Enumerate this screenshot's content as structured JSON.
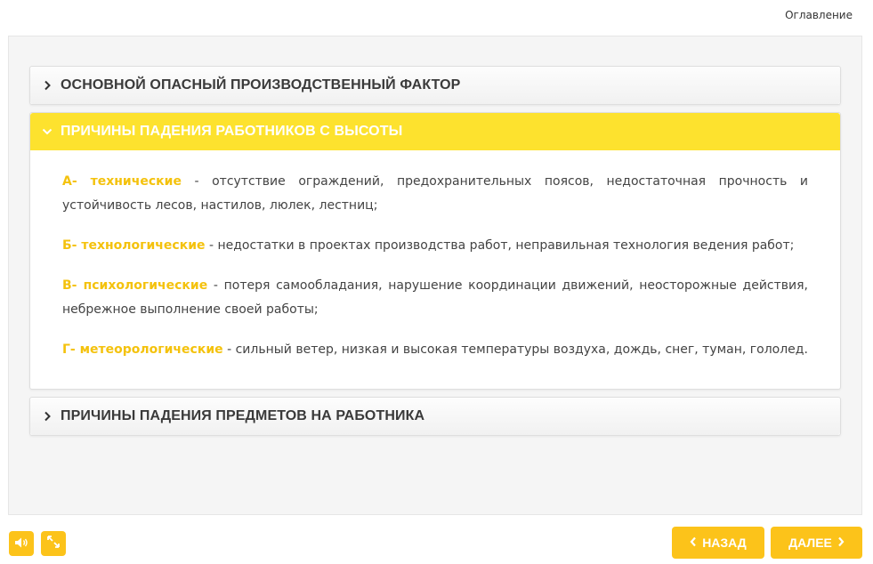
{
  "header": {
    "toc_label": "Оглавление"
  },
  "accordion": {
    "items": [
      {
        "title": "ОСНОВНОЙ ОПАСНЫЙ ПРОИЗВОДСТВЕННЫЙ ФАКТОР",
        "open": false
      },
      {
        "title": "ПРИЧИНЫ ПАДЕНИЯ РАБОТНИКОВ С ВЫСОТЫ",
        "open": true,
        "paragraphs": [
          {
            "term": "А- технические",
            "text": " - отсутствие ограждений, предохранительных поясов, недостаточная прочность и устойчивость лесов, настилов, люлек, лестниц;"
          },
          {
            "term": "Б- технологические",
            "text": " - недостатки в проектах производства работ, неправильная технология ведения работ;"
          },
          {
            "term": "В- психологические",
            "text": " - потеря самообладания, нарушение координации движений, неосторожные действия, небрежное выполнение своей работы;"
          },
          {
            "term": "Г- метеорологические",
            "text": " - сильный ветер, низкая и высокая температуры воздуха, дождь, снег, туман, гололед."
          }
        ]
      },
      {
        "title": "ПРИЧИНЫ ПАДЕНИЯ ПРЕДМЕТОВ НА РАБОТНИКА",
        "open": false
      }
    ]
  },
  "controls": {
    "sound_icon": "speaker-icon",
    "fullscreen_icon": "fullscreen-icon",
    "back_label": "НАЗАД",
    "next_label": "ДАЛЕЕ"
  },
  "colors": {
    "accent": "#fcc31a",
    "open_header": "#fde22e",
    "term": "#f4c20d"
  }
}
